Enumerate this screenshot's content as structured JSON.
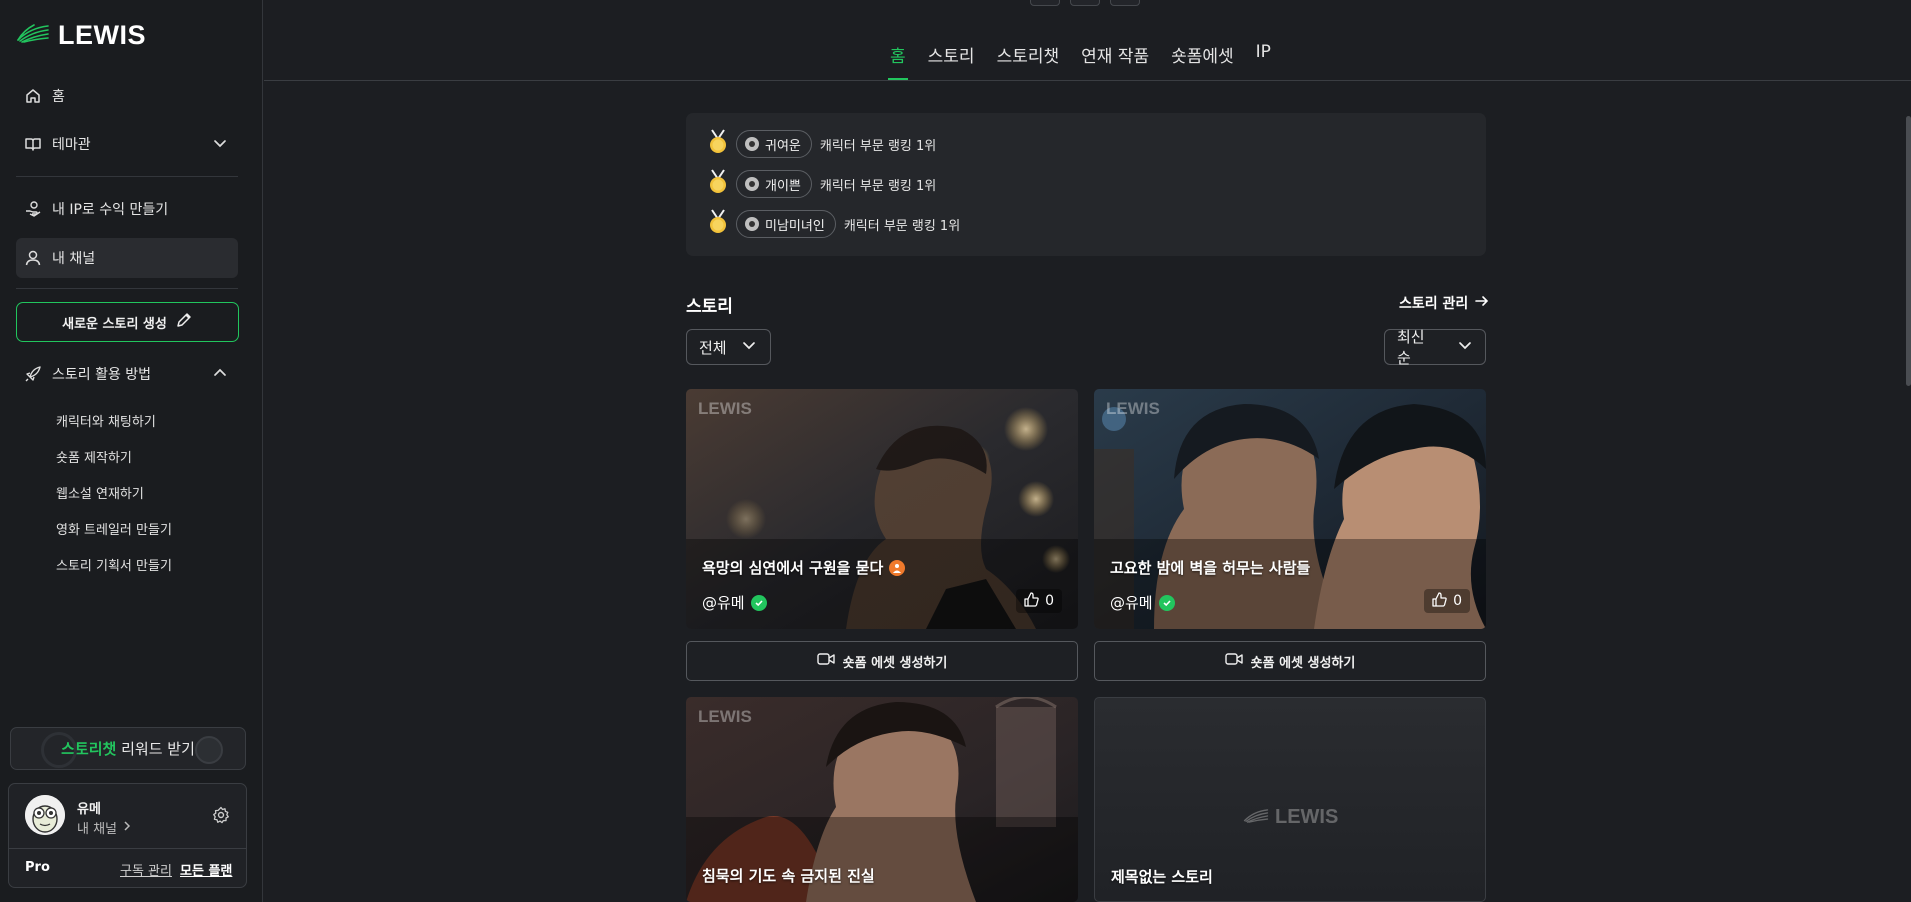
{
  "sidebar": {
    "logo": "LEWIS",
    "nav": {
      "home": "홈",
      "theme": "테마관",
      "ip_earn": "내 IP로 수익 만들기",
      "my_channel": "내 채널"
    },
    "new_story_button": "새로운 스토리 생성",
    "howto": {
      "title": "스토리 활용 방법",
      "items": [
        "캐릭터와 채팅하기",
        "숏폼 제작하기",
        "웹소설 연재하기",
        "영화 트레일러 만들기",
        "스토리 기획서 만들기"
      ]
    },
    "reward": {
      "highlight": "스토리챗",
      "text": " 리워드 받기"
    },
    "profile": {
      "name": "유메",
      "channel_link": "내 채널",
      "plan": "Pro",
      "subscription_link": "구독 관리",
      "all_plans_link": "모든 플랜"
    }
  },
  "tabs": [
    "홈",
    "스토리",
    "스토리챗",
    "연재 작품",
    "숏폼에셋",
    "IP"
  ],
  "active_tab": 0,
  "ranking": [
    {
      "tag": "귀여운",
      "text": "캐릭터 부문 랭킹 1위"
    },
    {
      "tag": "개이쁜",
      "text": "캐릭터 부문 랭킹 1위"
    },
    {
      "tag": "미남미녀인",
      "text": "캐릭터 부문 랭킹 1위"
    }
  ],
  "story_section": {
    "title": "스토리",
    "manage_link": "스토리 관리",
    "filter_value": "전체",
    "sort_value": "최신 순"
  },
  "cards": [
    {
      "watermark": "LEWIS",
      "title": "욕망의 심연에서 구원을 묻다",
      "author": "@유메",
      "likes": "0",
      "asset_button": "숏폼 에셋 생성하기"
    },
    {
      "watermark": "LEWIS",
      "title": "고요한 밤에 벽을 허무는 사람들",
      "author": "@유메",
      "likes": "0",
      "asset_button": "숏폼 에셋 생성하기"
    },
    {
      "watermark": "LEWIS",
      "title": "침묵의 기도 속 금지된 진실"
    },
    {
      "watermark": "LEWIS",
      "title": "제목없는 스토리"
    }
  ],
  "colors": {
    "accent": "#22c55e",
    "background": "#1c1e22",
    "sidebar": "#1a1c1f"
  }
}
